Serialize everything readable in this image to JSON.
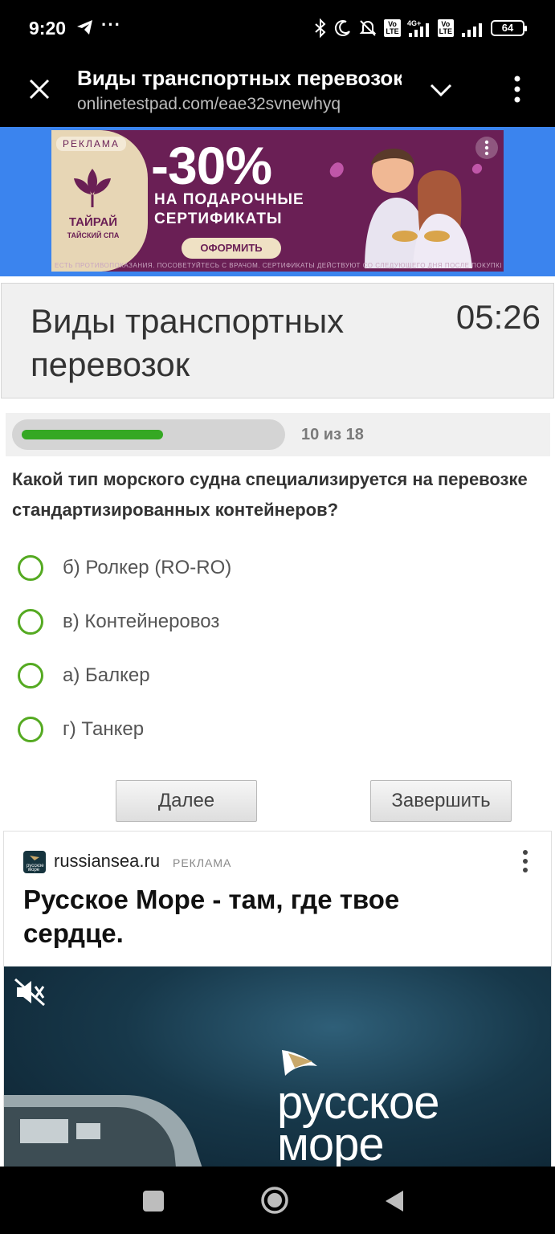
{
  "status_bar": {
    "time": "9:20",
    "dots": "···",
    "volte1": "Vo\nLTE",
    "net": "4G+",
    "volte2": "Vo\nLTE",
    "battery": "64"
  },
  "browser": {
    "title": "Виды транспортных перевозок",
    "url": "onlinetestpad.com/eae32svnewhyq"
  },
  "top_ad": {
    "badge": "РЕКЛАМА",
    "brand": "ТАЙРАЙ",
    "brand_sub": "ТАЙСКИЙ СПА",
    "discount": "-30%",
    "line1": "НА ПОДАРОЧНЫЕ",
    "line2": "СЕРТИФИКАТЫ",
    "cta": "ОФОРМИТЬ",
    "fine_print": "ЕСТЬ ПРОТИВОПОКАЗАНИЯ. ПОСОВЕТУЙТЕСЬ С ВРАЧОМ. СЕРТИФИКАТЫ ДЕЙСТВУЮТ СО СЛЕДУЮЩЕГО ДНЯ ПОСЛЕ ПОКУПКИ",
    "colors": {
      "band": "#3b84ee",
      "background": "#6a1f55",
      "panel": "#e7d6b5"
    }
  },
  "test": {
    "title": "Виды транспортных перевозок",
    "timer": "05:26",
    "progress_text": "10 из 18",
    "progress_value": 0.556,
    "progress_color": "#35a823",
    "question": "Какой тип морского судна специализируется на перевозке стандартизированных контейнеров?",
    "options": [
      {
        "label": "б) Ролкер (RO-RO)"
      },
      {
        "label": "в) Контейнеровоз"
      },
      {
        "label": "а) Балкер"
      },
      {
        "label": "г) Танкер"
      }
    ],
    "next_label": "Далее",
    "finish_label": "Завершить"
  },
  "bottom_ad": {
    "domain": "russiansea.ru",
    "badge": "РЕКЛАМА",
    "headline": "Русское Море - там, где твое сердце.",
    "logo_text": "русское море",
    "favicon_text": "русское море"
  },
  "icons": [
    "telegram-icon",
    "bluetooth-icon",
    "moon-icon",
    "mute-notification-icon",
    "signal-icon",
    "battery-icon",
    "close-icon",
    "chevron-down-icon",
    "more-vertical-icon",
    "mute-icon",
    "recents-icon",
    "home-icon",
    "back-icon"
  ]
}
